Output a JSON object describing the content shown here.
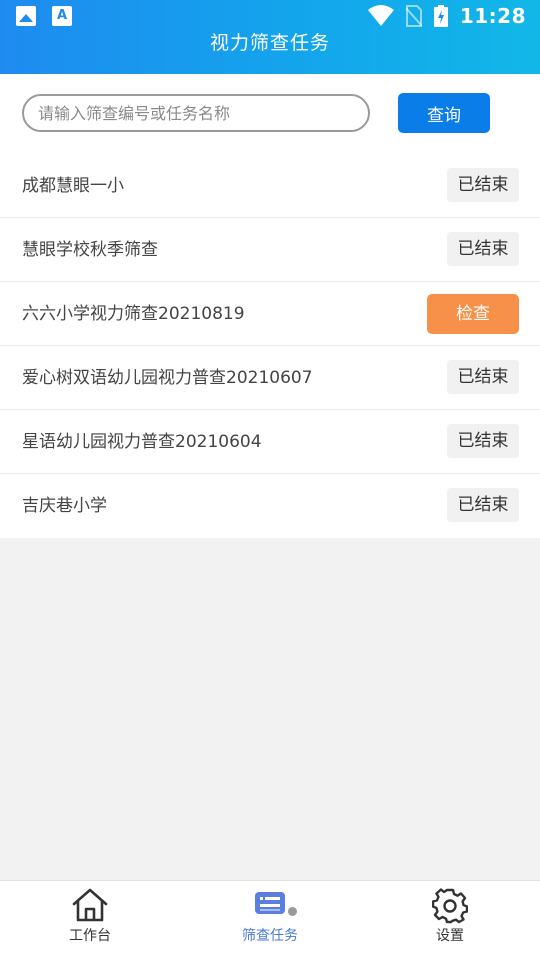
{
  "status_bar": {
    "time": "11:28",
    "icons": [
      "image-icon",
      "a-text-icon",
      "wifi-icon",
      "no-sim-icon",
      "battery-charging-icon"
    ]
  },
  "header": {
    "title": "视力筛查任务"
  },
  "search": {
    "placeholder": "请输入筛查编号或任务名称",
    "value": "",
    "button_label": "查询"
  },
  "tasks": [
    {
      "name": "成都慧眼一小",
      "status": "已结束"
    },
    {
      "name": "慧眼学校秋季筛查",
      "status": "已结束"
    },
    {
      "name": "六六小学视力筛查20210819",
      "action": "检查"
    },
    {
      "name": "爱心树双语幼儿园视力普查20210607",
      "status": "已结束"
    },
    {
      "name": "星语幼儿园视力普查20210604",
      "status": "已结束"
    },
    {
      "name": "吉庆巷小学",
      "status": "已结束"
    }
  ],
  "nav": {
    "tabs": [
      {
        "label": "工作台",
        "icon": "home-icon"
      },
      {
        "label": "筛查任务",
        "icon": "task-list-icon",
        "active": true
      },
      {
        "label": "设置",
        "icon": "gear-icon"
      }
    ]
  },
  "colors": {
    "header_gradient_start": "#1e8bf0",
    "header_gradient_end": "#12b7e8",
    "primary_button": "#0a7de8",
    "action_button": "#f7914a",
    "active_tab": "#4a79d8"
  }
}
